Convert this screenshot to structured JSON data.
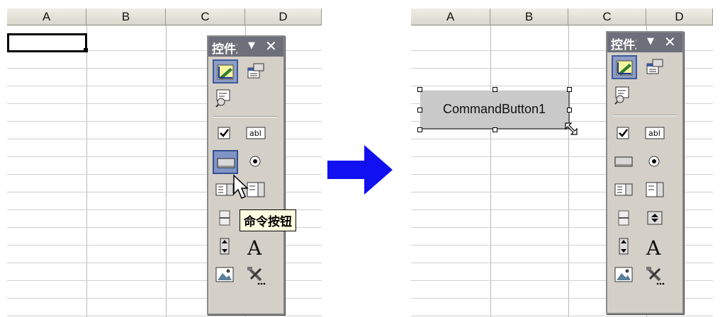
{
  "left_sheet": {
    "columns": [
      "A",
      "B",
      "C",
      "D"
    ]
  },
  "right_sheet": {
    "columns": [
      "A",
      "B",
      "C",
      "D"
    ],
    "command_button_label": "CommandButton1"
  },
  "toolbox": {
    "title": "控件工具箱",
    "dropdown_icon": "▼",
    "close_icon": "✕",
    "tools": [
      "design-mode-icon",
      "properties-icon",
      "view-code-icon",
      "checkbox-icon",
      "textbox-icon",
      "command-button-icon",
      "option-button-icon",
      "listbox-icon",
      "combobox-icon",
      "toggle-button-icon",
      "spin-button-icon",
      "scrollbar-icon",
      "label-icon",
      "image-icon",
      "more-controls-icon"
    ],
    "label_tool_glyph": "A"
  },
  "tooltip": {
    "text": "命令按钮"
  },
  "arrow": {
    "color": "#1010f0",
    "icon": "right-arrow-icon"
  }
}
